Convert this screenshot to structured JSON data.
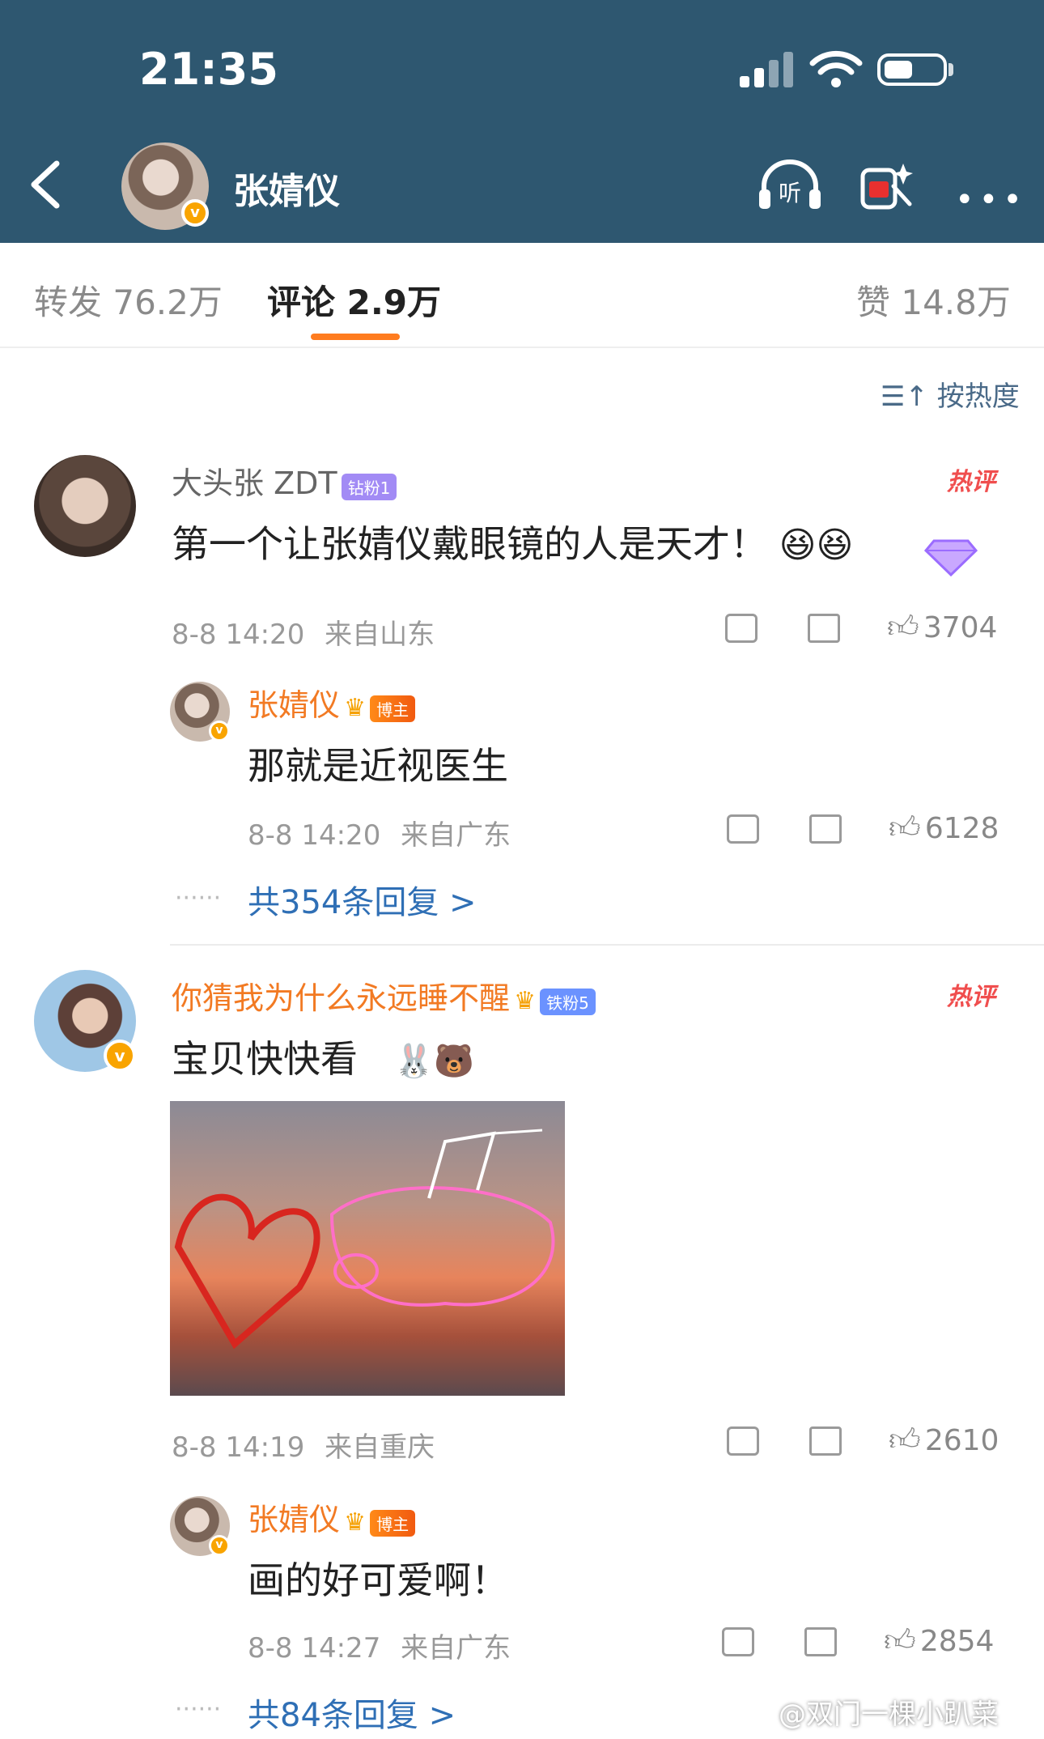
{
  "status_bar": {
    "time": "21:35"
  },
  "header": {
    "name": "张婧仪",
    "avatar_badge": "v"
  },
  "tabs": [
    {
      "label": "转发 76.2万"
    },
    {
      "label": "评论 2.9万"
    },
    {
      "label": "赞 14.8万"
    }
  ],
  "sort": {
    "label": "按热度"
  },
  "comments": [
    {
      "user": "大头张 ZDT",
      "badge": "钻粉1",
      "hot_label": "热评",
      "text": "第一个让张婧仪戴眼镜的人是天才！",
      "time": "8-8 14:20",
      "location": "来自山东",
      "likes": "3704",
      "reply": {
        "user": "张婧仪",
        "badge": "博主",
        "text": "那就是近视医生",
        "time": "8-8 14:20",
        "location": "来自广东",
        "likes": "6128"
      },
      "more_replies": "共354条回复 >"
    },
    {
      "user": "你猜我为什么永远睡不醒",
      "badge": "铁粉5",
      "hot_label": "热评",
      "text": "宝贝快快看",
      "time": "8-8 14:19",
      "location": "来自重庆",
      "likes": "2610",
      "reply": {
        "user": "张婧仪",
        "badge": "博主",
        "text": "画的好可爱啊！",
        "time": "8-8 14:27",
        "location": "来自广东",
        "likes": "2854"
      },
      "more_replies": "共84条回复 >"
    }
  ],
  "watermark": "@双门一棵小趴菜",
  "colors": {
    "header_bg": "#2e5770",
    "accent_orange": "#ff7c1f",
    "link_blue": "#2f6fb5",
    "hot_red": "#f04e4e"
  }
}
